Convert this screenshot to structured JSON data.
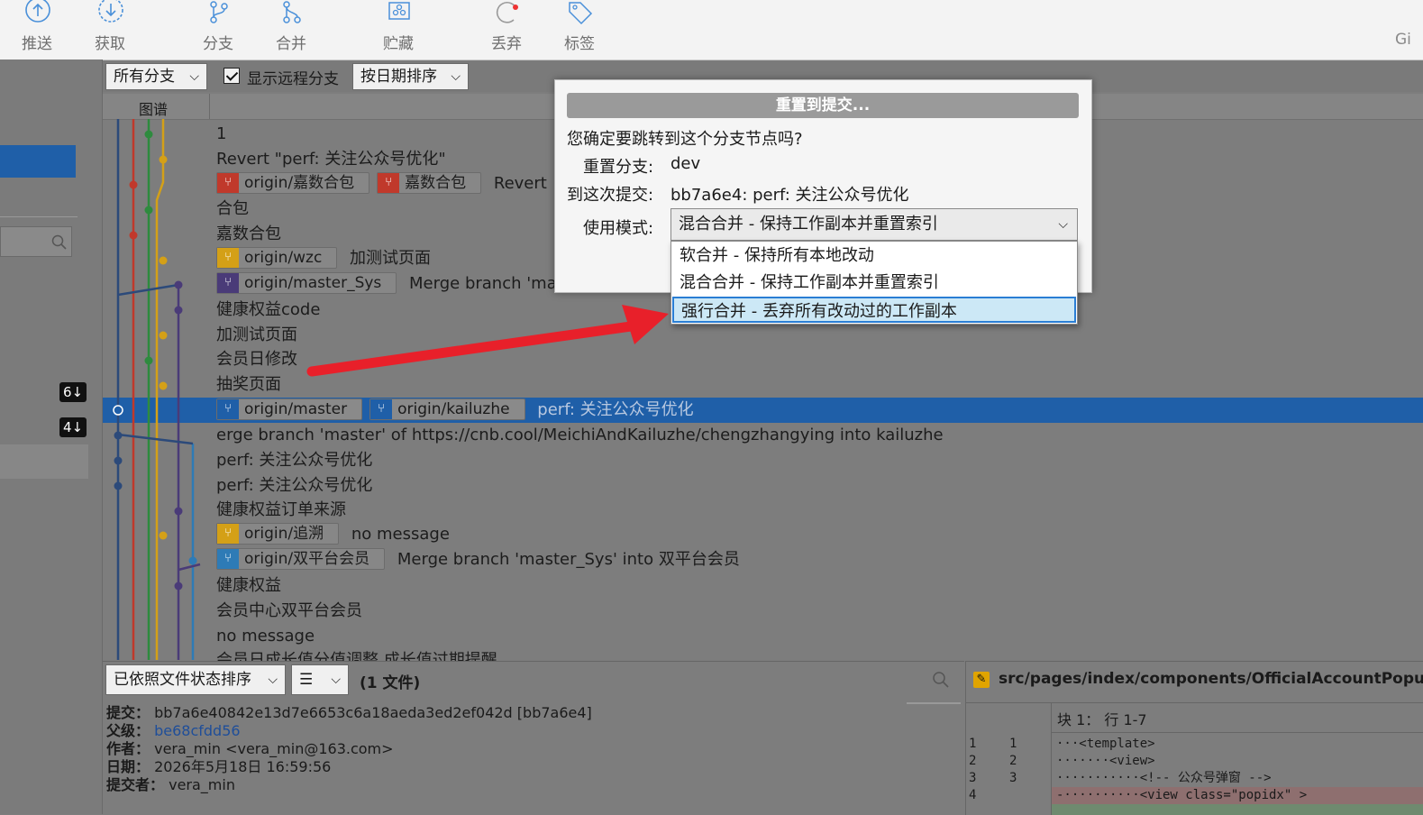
{
  "toolbar": {
    "buttons": [
      {
        "label": "推送",
        "icon": "push-icon"
      },
      {
        "label": "获取",
        "icon": "fetch-icon"
      },
      {
        "label": "分支",
        "icon": "branch-icon"
      },
      {
        "label": "合并",
        "icon": "merge-icon"
      },
      {
        "label": "贮藏",
        "icon": "stash-icon"
      },
      {
        "label": "丢弃",
        "icon": "discard-icon"
      },
      {
        "label": "标签",
        "icon": "tag-icon"
      }
    ],
    "right_text": "Gi"
  },
  "filters": {
    "branch_select": "所有分支",
    "show_remote_label": "显示远程分支",
    "show_remote_checked": true,
    "sort_select": "按日期排序"
  },
  "left_panel": {
    "badge1": "6↓",
    "badge2": "4↓"
  },
  "graph": {
    "header": "图谱",
    "rows": [
      {
        "tags": [],
        "message": "1"
      },
      {
        "tags": [],
        "message": "Revert \"perf: 关注公众号优化\""
      },
      {
        "tags": [
          {
            "name": "origin/嘉数合包",
            "color": "#c0392b"
          },
          {
            "name": "嘉数合包",
            "color": "#c0392b"
          }
        ],
        "message": "Revert"
      },
      {
        "tags": [],
        "message": "合包"
      },
      {
        "tags": [],
        "message": "嘉数合包"
      },
      {
        "tags": [
          {
            "name": "origin/wzc",
            "color": "#d4a017"
          }
        ],
        "message": "加测试页面"
      },
      {
        "tags": [
          {
            "name": "origin/master_Sys",
            "color": "#4a3b78"
          }
        ],
        "message": "Merge branch 'mast"
      },
      {
        "tags": [],
        "message": "健康权益code"
      },
      {
        "tags": [],
        "message": "加测试页面"
      },
      {
        "tags": [],
        "message": "会员日修改"
      },
      {
        "tags": [],
        "message": "抽奖页面"
      },
      {
        "tags": [
          {
            "name": "origin/master",
            "color": "#1f5fa8"
          },
          {
            "name": "origin/kailuzhe",
            "color": "#1f5fa8"
          }
        ],
        "message": "perf: 关注公众号优化",
        "selected": true
      },
      {
        "tags": [],
        "message": "erge branch 'master' of https://cnb.cool/MeichiAndKailuzhe/chengzhangying into kailuzhe"
      },
      {
        "tags": [],
        "message": "perf: 关注公众号优化"
      },
      {
        "tags": [],
        "message": "perf: 关注公众号优化"
      },
      {
        "tags": [],
        "message": "健康权益订单来源"
      },
      {
        "tags": [
          {
            "name": "origin/追溯",
            "color": "#d4a017"
          }
        ],
        "message": "no message"
      },
      {
        "tags": [
          {
            "name": "origin/双平台会员",
            "color": "#2e7bb6"
          }
        ],
        "message": "Merge branch 'master_Sys' into 双平台会员"
      },
      {
        "tags": [],
        "message": "健康权益"
      },
      {
        "tags": [],
        "message": "会员中心双平台会员"
      },
      {
        "tags": [],
        "message": "no message"
      },
      {
        "tags": [],
        "message": "会员日成长值分值调整 成长值过期提醒"
      }
    ]
  },
  "bottom_left": {
    "sort_select": "已依照文件状态排序",
    "view_select": "☰",
    "file_count": "(1 文件)",
    "commit_label": "提交：",
    "commit_value": "bb7a6e40842e13d7e6653c6a18aeda3ed2ef042d [bb7a6e4]",
    "parent_label": "父级：",
    "parent_value": "be68cfdd56",
    "author_label": "作者：",
    "author_value": "vera_min <vera_min@163.com>",
    "date_label": "日期：",
    "date_value": "2026年5月18日 16:59:56",
    "committer_label": "提交者：",
    "committer_value": "vera_min"
  },
  "bottom_right": {
    "file_path": "src/pages/index/components/OfficialAccountPopup/Of",
    "hunk_header": "块 1： 行 1-7",
    "lines": [
      {
        "old": "1",
        "new": "1",
        "text": "···<template>"
      },
      {
        "old": "2",
        "new": "2",
        "text": "·······<view>"
      },
      {
        "old": "3",
        "new": "3",
        "text": "···········<!-- 公众号弹窗 -->"
      },
      {
        "old": "4",
        "new": "",
        "text": "-··········<view class=\"popidx\" >"
      }
    ]
  },
  "dialog": {
    "title": "重置到提交...",
    "question": "您确定要跳转到这个分支节点吗?",
    "branch_label": "重置分支:",
    "branch_value": "dev",
    "commit_label": "到这次提交:",
    "commit_value": "bb7a6e4: perf: 关注公众号优化",
    "mode_label": "使用模式:",
    "mode_selected": "混合合并 - 保持工作副本并重置索引",
    "options": [
      "软合并 - 保持所有本地改动",
      "混合合并 - 保持工作副本并重置索引",
      "强行合并 - 丢弃所有改动过的工作副本"
    ],
    "highlighted_option": 2
  },
  "colors": {
    "selection": "#1f5fa8",
    "arrow": "#e8202a",
    "dropdown_highlight": "#cce8f6"
  }
}
